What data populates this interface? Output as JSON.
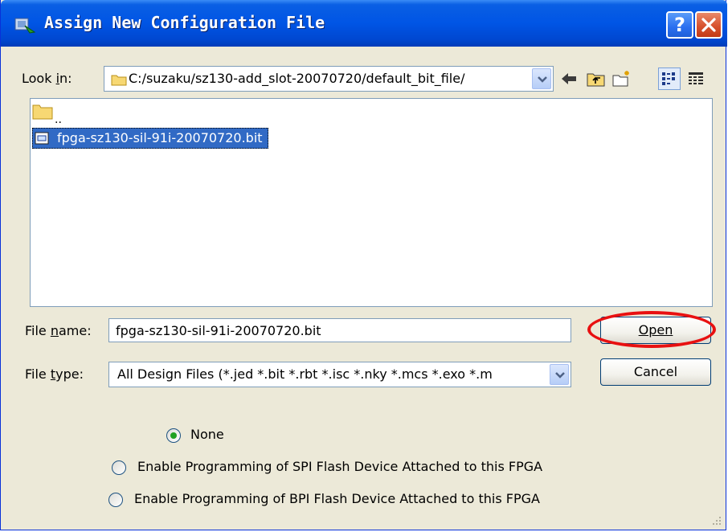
{
  "window": {
    "title": "Assign New Configuration File"
  },
  "lookin": {
    "label": "Look in:",
    "path": "C:/suzaku/sz130-add_slot-20070720/default_bit_file/"
  },
  "file_list": {
    "parent_label": "..",
    "items": [
      {
        "name": "fpga-sz130-sil-91i-20070720.bit",
        "selected": true
      }
    ]
  },
  "filename": {
    "label": "File name:",
    "value": "fpga-sz130-sil-91i-20070720.bit"
  },
  "filetype": {
    "label": "File type:",
    "value": "All Design Files (*.jed *.bit *.rbt *.isc *.nky *.mcs *.exo *.m"
  },
  "buttons": {
    "open": "Open",
    "cancel": "Cancel",
    "help": "?"
  },
  "options": [
    {
      "label": "None",
      "selected": true
    },
    {
      "label": "Enable Programming of SPI Flash Device Attached to this FPGA",
      "selected": false
    },
    {
      "label": "Enable Programming of BPI Flash Device Attached to this FPGA",
      "selected": false
    }
  ],
  "colors": {
    "title_bar": "#0055e5",
    "selection": "#316ac5",
    "annotation_circle": "#e81010"
  }
}
